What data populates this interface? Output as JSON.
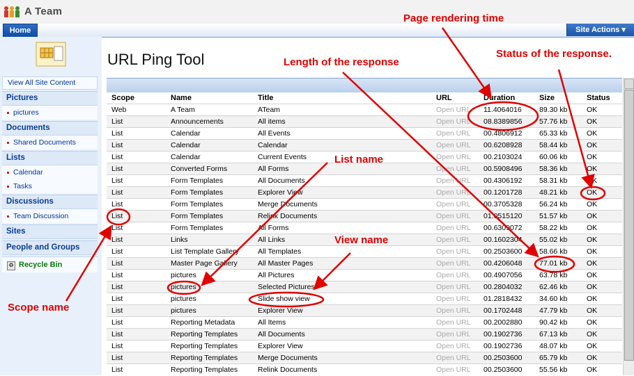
{
  "site": {
    "title": "A Team",
    "logo_icon": "people-group-icon"
  },
  "nav": {
    "home_tab": "Home",
    "site_actions": "Site Actions ▾"
  },
  "sidebar": {
    "view_all": "View All Site Content",
    "sections": [
      {
        "header": "Pictures",
        "items": [
          "pictures"
        ]
      },
      {
        "header": "Documents",
        "items": [
          "Shared Documents"
        ]
      },
      {
        "header": "Lists",
        "items": [
          "Calendar",
          "Tasks"
        ]
      },
      {
        "header": "Discussions",
        "items": [
          "Team Discussion"
        ]
      },
      {
        "header": "Sites",
        "items": []
      },
      {
        "header": "People and Groups",
        "items": []
      }
    ],
    "recycle_bin": "Recycle Bin"
  },
  "page": {
    "title": "URL Ping Tool"
  },
  "table": {
    "headers": [
      "Scope",
      "Name",
      "Title",
      "URL",
      "Duration",
      "Size",
      "Status"
    ],
    "rows": [
      [
        "Web",
        "A Team",
        "ATeam",
        "Open URL",
        "11.4064016",
        "89.30 kb",
        "OK"
      ],
      [
        "List",
        "Announcements",
        "All items",
        "Open URL",
        "08.8389856",
        "57.76 kb",
        "OK"
      ],
      [
        "List",
        "Calendar",
        "All Events",
        "Open URL",
        "00.4806912",
        "65.33 kb",
        "OK"
      ],
      [
        "List",
        "Calendar",
        "Calendar",
        "Open URL",
        "00.6208928",
        "58.44 kb",
        "OK"
      ],
      [
        "List",
        "Calendar",
        "Current Events",
        "Open URL",
        "00.2103024",
        "60.06 kb",
        "OK"
      ],
      [
        "List",
        "Converted Forms",
        "All Forms",
        "Open URL",
        "00.5908496",
        "58.36 kb",
        "OK"
      ],
      [
        "List",
        "Form Templates",
        "All Documents",
        "Open URL",
        "00.4306192",
        "58.31 kb",
        "OK"
      ],
      [
        "List",
        "Form Templates",
        "Explorer View",
        "Open URL",
        "00.1201728",
        "48.21 kb",
        "OK"
      ],
      [
        "List",
        "Form Templates",
        "Merge Documents",
        "Open URL",
        "00.3705328",
        "56.24 kb",
        "OK"
      ],
      [
        "List",
        "Form Templates",
        "Relink Documents",
        "Open URL",
        "01.0515120",
        "51.57 kb",
        "OK"
      ],
      [
        "List",
        "Form Templates",
        "All Forms",
        "Open URL",
        "00.6309072",
        "58.22 kb",
        "OK"
      ],
      [
        "List",
        "Links",
        "All Links",
        "Open URL",
        "00.1602304",
        "55.02 kb",
        "OK"
      ],
      [
        "List",
        "List Template Gallery",
        "All Templates",
        "Open URL",
        "00.2503600",
        "58.66 kb",
        "OK"
      ],
      [
        "List",
        "Master Page Gallery",
        "All Master Pages",
        "Open URL",
        "00.4206048",
        "77.01 kb",
        "OK"
      ],
      [
        "List",
        "pictures",
        "All Pictures",
        "Open URL",
        "00.4907056",
        "63.78 kb",
        "OK"
      ],
      [
        "List",
        "pictures",
        "Selected Pictures",
        "Open URL",
        "00.2804032",
        "62.46 kb",
        "OK"
      ],
      [
        "List",
        "pictures",
        "Slide show view",
        "Open URL",
        "01.2818432",
        "34.60 kb",
        "OK"
      ],
      [
        "List",
        "pictures",
        "Explorer View",
        "Open URL",
        "00.1702448",
        "47.79 kb",
        "OK"
      ],
      [
        "List",
        "Reporting Metadata",
        "All Items",
        "Open URL",
        "00.2002880",
        "90.42 kb",
        "OK"
      ],
      [
        "List",
        "Reporting Templates",
        "All Documents",
        "Open URL",
        "00.1902736",
        "67.13 kb",
        "OK"
      ],
      [
        "List",
        "Reporting Templates",
        "Explorer View",
        "Open URL",
        "00.1902736",
        "48.07 kb",
        "OK"
      ],
      [
        "List",
        "Reporting Templates",
        "Merge Documents",
        "Open URL",
        "00.2503600",
        "65.79 kb",
        "OK"
      ],
      [
        "List",
        "Reporting Templates",
        "Relink Documents",
        "Open URL",
        "00.2503600",
        "55.56 kb",
        "OK"
      ]
    ]
  },
  "annotations": {
    "page_rendering_time": "Page rendering time",
    "length_of_response": "Length of the response",
    "status_of_response": "Status of the response.",
    "list_name": "List name",
    "view_name": "View name",
    "scope_name": "Scope name",
    "color": "#e00000"
  }
}
